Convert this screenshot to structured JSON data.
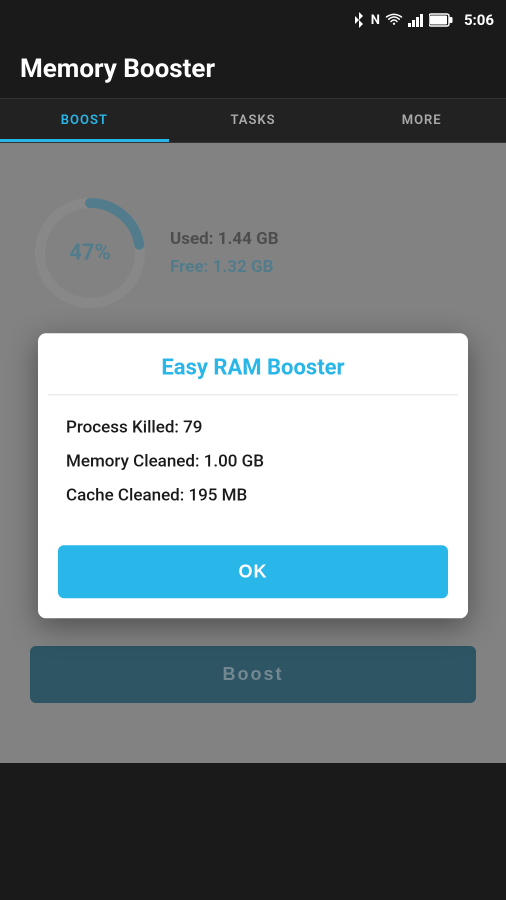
{
  "statusBar": {
    "time": "5:06",
    "battery": "91%",
    "signals": [
      "bluetooth",
      "wifi",
      "signal",
      "battery"
    ]
  },
  "header": {
    "title": "Memory Booster"
  },
  "tabs": [
    {
      "label": "BOOST",
      "active": true
    },
    {
      "label": "TASKS",
      "active": false
    },
    {
      "label": "MORE",
      "active": false
    }
  ],
  "memoryInfo": {
    "percent": "47%",
    "usedLabel": "Used:",
    "usedValue": "1.44 GB",
    "freeLabel": "Free:",
    "freeValue": "1.32 GB"
  },
  "dialog": {
    "title": "Easy RAM Booster",
    "processKilledLabel": "Process Killed:",
    "processKilledValue": "79",
    "memoryCleanedLabel": "Memory Cleaned:",
    "memoryCleanedValue": "1.00 GB",
    "cacheCleanedLabel": "Cache Cleaned:",
    "cacheCleanedValue": "195 MB",
    "okButton": "OK"
  },
  "boostButton": {
    "label": "Boost"
  }
}
